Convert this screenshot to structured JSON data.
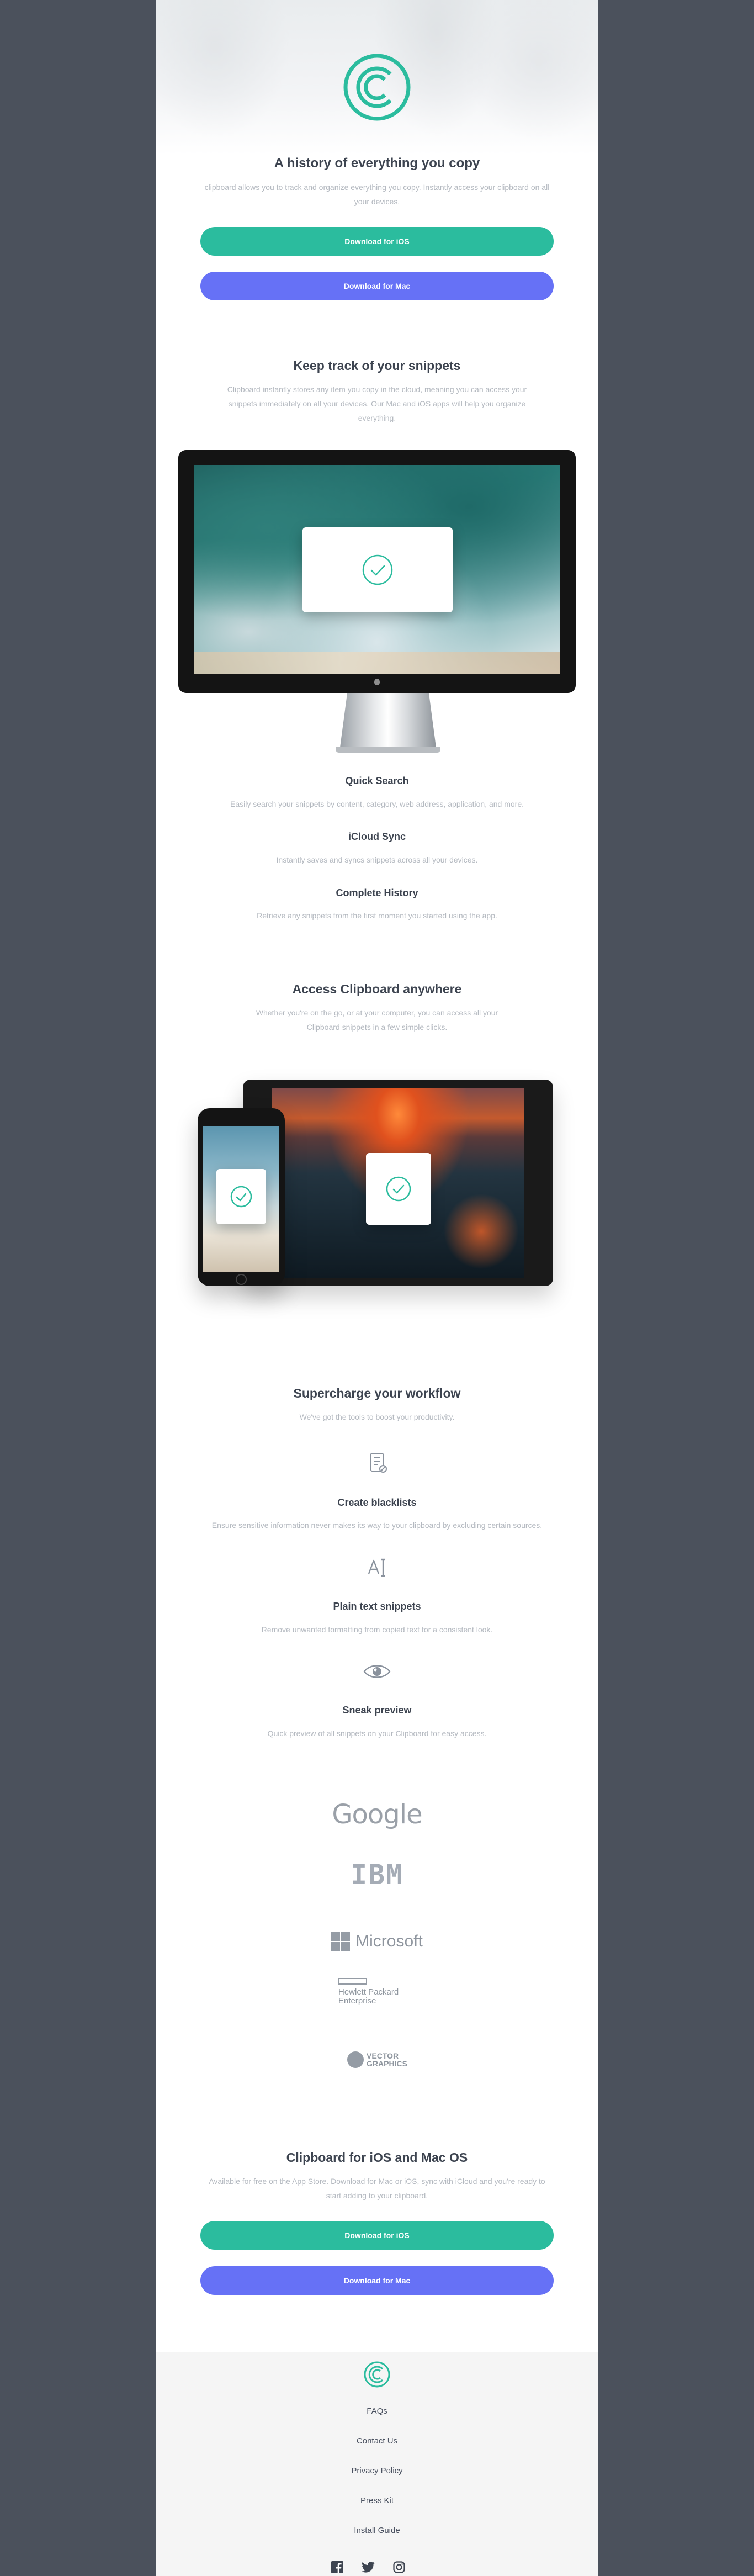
{
  "hero": {
    "title": "A history of everything you copy",
    "description": "clipboard allows you to track and organize everything you copy. Instantly access your clipboard on all your devices.",
    "ios_button": "Download for iOS",
    "mac_button": "Download for Mac"
  },
  "snippets": {
    "title": "Keep track of your snippets",
    "description": "Clipboard instantly stores any item you copy in the cloud, meaning you can access your snippets immediately on all your devices. Our Mac and iOS apps will help you organize everything.",
    "features": [
      {
        "title": "Quick Search",
        "text": "Easily search your snippets by content, category, web address, application, and more."
      },
      {
        "title": "iCloud Sync",
        "text": "Instantly saves and syncs snippets across all your devices."
      },
      {
        "title": "Complete History",
        "text": "Retrieve any snippets from the first moment you started using the app."
      }
    ]
  },
  "access": {
    "title": "Access Clipboard anywhere",
    "description": "Whether you're on the go, or at your computer, you can access all your Clipboard snippets in a few simple clicks."
  },
  "workflow": {
    "title": "Supercharge your workflow",
    "subtitle": "We've got the tools to boost your productivity.",
    "items": [
      {
        "icon": "blacklist-icon",
        "title": "Create blacklists",
        "text": "Ensure sensitive information never makes its way to your clipboard by excluding certain sources."
      },
      {
        "icon": "text-icon",
        "title": "Plain text snippets",
        "text": "Remove unwanted formatting from copied text for a consistent look."
      },
      {
        "icon": "eye-icon",
        "title": "Sneak preview",
        "text": "Quick preview of all snippets on your Clipboard for easy access."
      }
    ]
  },
  "brands": {
    "google": "Google",
    "ibm": "IBM",
    "microsoft": "Microsoft",
    "hp_line1": "Hewlett Packard",
    "hp_line2": "Enterprise",
    "vector_line1": "VECTOR",
    "vector_line2": "GRAPHICS"
  },
  "cta": {
    "title": "Clipboard for iOS and Mac OS",
    "description": "Available for free on the App Store. Download for Mac or iOS, sync with iCloud and you're ready to start adding to your clipboard.",
    "ios_button": "Download for iOS",
    "mac_button": "Download for Mac"
  },
  "footer": {
    "links": [
      "FAQs",
      "Contact Us",
      "Privacy Policy",
      "Press Kit",
      "Install Guide"
    ],
    "social": [
      "facebook-icon",
      "twitter-icon",
      "instagram-icon"
    ]
  },
  "colors": {
    "accent": "#2bbc9e",
    "secondary": "#6671f6",
    "outer_background": "#4b515c"
  }
}
